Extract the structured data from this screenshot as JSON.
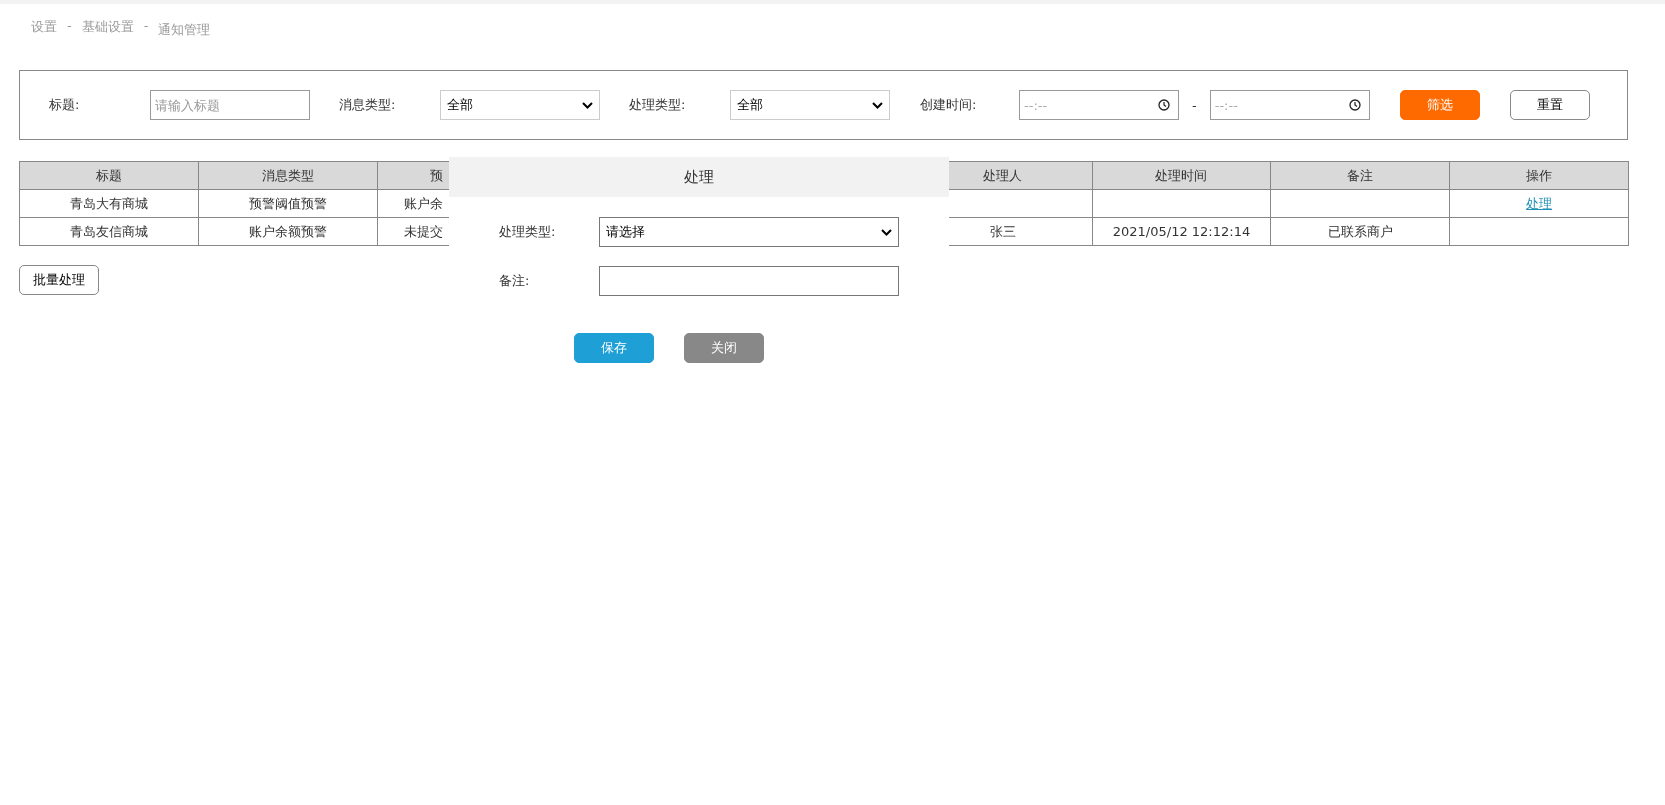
{
  "breadcrumb": {
    "items": [
      "设置",
      "基础设置",
      "通知管理"
    ],
    "separator": "-"
  },
  "filters": {
    "title": {
      "label": "标题:",
      "placeholder": "请输入标题"
    },
    "message_type": {
      "label": "消息类型:",
      "value": "全部"
    },
    "handle_type": {
      "label": "处理类型:",
      "value": "全部"
    },
    "created_time": {
      "label": "创建时间:",
      "start_placeholder": "--:--",
      "separator": "-",
      "end_placeholder": "--:--"
    },
    "buttons": {
      "filter": "筛选",
      "reset": "重置"
    }
  },
  "table": {
    "columns": [
      "标题",
      "消息类型",
      "预",
      "处理人",
      "处理时间",
      "备注",
      "操作"
    ],
    "rows": [
      {
        "title": "青岛大有商城",
        "message_type": "预警阈值预警",
        "column_3": "账户余",
        "action": "处理"
      },
      {
        "title": "青岛友信商城",
        "message_type": "账户余额预警",
        "column_3": "未提交",
        "handler": "张三",
        "handled_time": "2021/05/12 12:12:14",
        "remark": "已联系商户"
      }
    ]
  },
  "batch_button": "批量处理",
  "dialog": {
    "title": "处理",
    "fields": [
      {
        "kind": "select",
        "label": "处理类型:",
        "value": "请选择"
      },
      {
        "kind": "text",
        "label": "备注:"
      }
    ],
    "buttons": [
      {
        "kind": "primary",
        "label": "保存"
      },
      {
        "kind": "secondary",
        "label": "关闭"
      }
    ]
  }
}
